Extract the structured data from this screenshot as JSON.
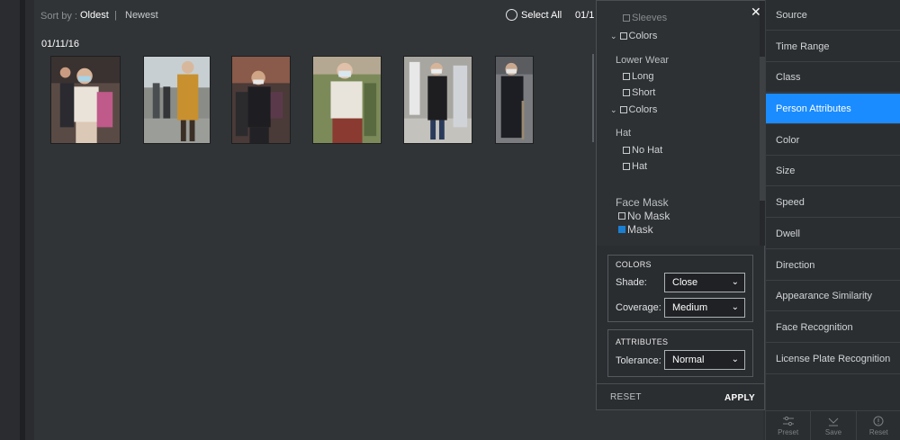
{
  "sort": {
    "label": "Sort by :",
    "oldest": "Oldest",
    "separator": "|",
    "newest": "Newest"
  },
  "select_all": "Select All",
  "date_cut": "01/1",
  "date_group": "01/11/16",
  "results_count": 6,
  "panel": {
    "partial_top": "Sleeves",
    "items": [
      {
        "type": "check",
        "label": "Colors",
        "chevron": true,
        "checked": false
      },
      {
        "type": "category",
        "label": "Lower Wear"
      },
      {
        "type": "check",
        "label": "Long",
        "checked": false
      },
      {
        "type": "check",
        "label": "Short",
        "checked": false
      },
      {
        "type": "check",
        "label": "Colors",
        "chevron": true,
        "checked": false
      },
      {
        "type": "category",
        "label": "Hat"
      },
      {
        "type": "check",
        "label": "No Hat",
        "checked": false
      },
      {
        "type": "check",
        "label": "Hat",
        "checked": false
      },
      {
        "type": "category",
        "label": "Face Mask"
      },
      {
        "type": "check",
        "label": "No Mask",
        "checked": false
      },
      {
        "type": "check",
        "label": "Mask",
        "checked": true
      }
    ],
    "colors": {
      "title": "COLORS",
      "shade_label": "Shade:",
      "shade_value": "Close",
      "coverage_label": "Coverage:",
      "coverage_value": "Medium"
    },
    "attributes": {
      "title": "ATTRIBUTES",
      "tolerance_label": "Tolerance:",
      "tolerance_value": "Normal"
    },
    "reset": "RESET",
    "apply": "APPLY"
  },
  "sidebar": {
    "items": [
      {
        "label": "Source",
        "active": false
      },
      {
        "label": "Time Range",
        "active": false
      },
      {
        "label": "Class",
        "active": false
      },
      {
        "label": "Person Attributes",
        "active": true
      },
      {
        "label": "Color",
        "active": false
      },
      {
        "label": "Size",
        "active": false
      },
      {
        "label": "Speed",
        "active": false
      },
      {
        "label": "Dwell",
        "active": false
      },
      {
        "label": "Direction",
        "active": false
      },
      {
        "label": "Appearance Similarity",
        "active": false
      },
      {
        "label": "Face Recognition",
        "active": false
      },
      {
        "label": "License Plate Recognition",
        "active": false
      }
    ],
    "footer": {
      "preset": "Preset",
      "save": "Save",
      "reset": "Reset"
    }
  },
  "colors": {
    "accent": "#1a8cff",
    "checked": "#1b7fd1"
  }
}
